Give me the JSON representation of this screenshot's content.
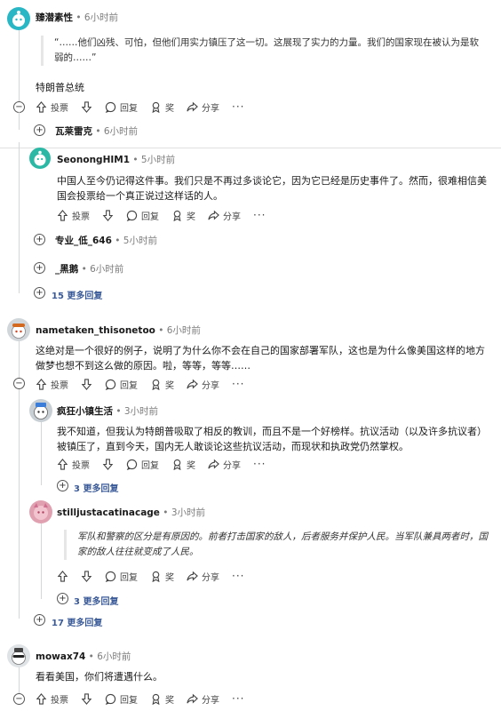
{
  "c1": {
    "username": "臻潜素性",
    "time": "6小时前",
    "quote": "“……他们凶残、可怕，但他们用实力镇压了这一切。这展现了实力的力量。我们的国家现在被认为是软弱的……”",
    "text": "特朗普总统"
  },
  "actions": {
    "vote": "投票",
    "reply": "回复",
    "award": "奖",
    "share": "分享",
    "more": "···"
  },
  "c1_child1": {
    "username": "瓦莱雷克",
    "time": "6小时前"
  },
  "c2": {
    "username": "SeonongHIM1",
    "time": "5小时前",
    "text": "中国人至今仍记得这件事。我们只是不再过多谈论它，因为它已经是历史事件了。然而，很难相信美国会投票给一个真正说过这样话的人。"
  },
  "c2_child1": {
    "username": "专业_低_646",
    "time": "5小时前"
  },
  "c2_child2": {
    "username": "_黑鹅",
    "time": "6小时前"
  },
  "c2_more": "15 更多回复",
  "c3": {
    "username": "nametaken_thisonetoo",
    "time": "6小时前",
    "text": "这绝对是一个很好的例子，说明了为什么你不会在自己的国家部署军队，这也是为什么像美国这样的地方做梦也想不到这么做的原因。啦，等等，等等……"
  },
  "c3_r1": {
    "username": "疯狂小镇生活",
    "time": "3小时前",
    "text": "我不知道，但我认为特朗普吸取了相反的教训，而且不是一个好榜样。抗议活动（以及许多抗议者）被镇压了，直到今天，国内无人敢谈论这些抗议活动，而现状和执政党仍然掌权。",
    "more": "3 更多回复"
  },
  "c3_r2": {
    "username": "stilljustacatinacage",
    "time": "3小时前",
    "quote": "军队和警察的区分是有原因的。前者打击国家的敌人，后者服务并保护人民。当军队兼具两者时，国家的敌人往往就变成了人民。",
    "more": "3 更多回复"
  },
  "c3_more": "17 更多回复",
  "c4": {
    "username": "mowax74",
    "time": "6小时前",
    "text": "看看美国，你们将遭遇什么。"
  },
  "colors": {
    "accent_teal": "#2bb8a5",
    "link_blue": "#3a5a98",
    "thread_line": "#d4d7d9"
  }
}
